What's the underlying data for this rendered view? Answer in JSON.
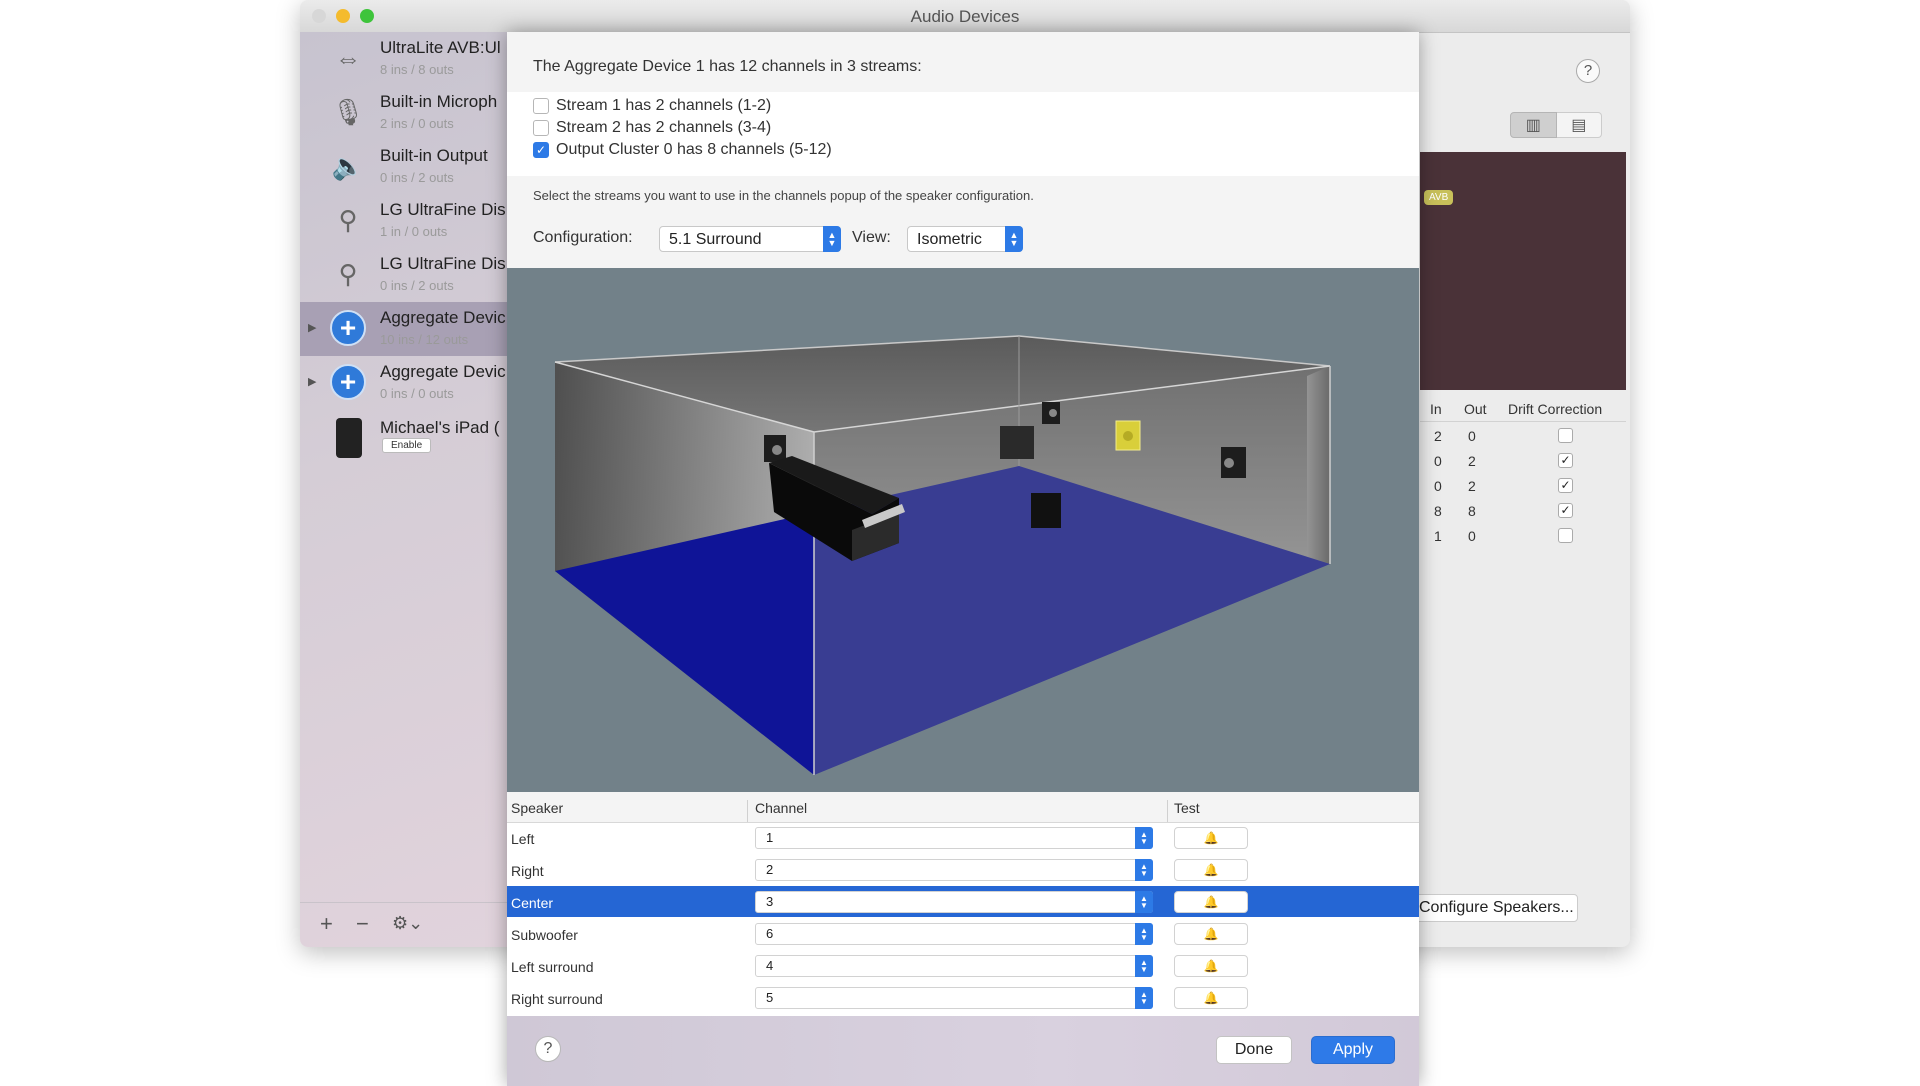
{
  "window": {
    "title": "Audio Devices"
  },
  "devices": [
    {
      "name": "UltraLite AVB:Ul",
      "sub": "8 ins / 8 outs",
      "icon": "arrows-lr-icon",
      "glyph": "⇔",
      "selected": false,
      "expandable": false
    },
    {
      "name": "Built-in Microph",
      "sub": "2 ins / 0 outs",
      "icon": "microphone-icon",
      "glyph": "🎙",
      "selected": false,
      "expandable": false
    },
    {
      "name": "Built-in Output",
      "sub": "0 ins / 2 outs",
      "icon": "speaker-icon",
      "glyph": "🔈",
      "selected": false,
      "expandable": false
    },
    {
      "name": "LG UltraFine Dis",
      "sub": "1 in / 0 outs",
      "icon": "usb-icon",
      "glyph": "⚲",
      "selected": false,
      "expandable": false
    },
    {
      "name": "LG UltraFine Dis",
      "sub": "0 ins / 2 outs",
      "icon": "usb-icon",
      "glyph": "⚲",
      "selected": false,
      "expandable": false
    },
    {
      "name": "Aggregate Devic",
      "sub": "10 ins / 12 outs",
      "icon": "aggregate-plus-icon",
      "glyph": "+",
      "selected": true,
      "expandable": true
    },
    {
      "name": "Aggregate Devic",
      "sub": "0 ins / 0 outs",
      "icon": "aggregate-plus-icon",
      "glyph": "+",
      "selected": false,
      "expandable": true
    }
  ],
  "ipad": {
    "name": "Michael's iPad (",
    "enable_label": "Enable"
  },
  "sidebar_bottom": {
    "add": "+",
    "remove": "−",
    "gear": "⚙⌄"
  },
  "right_pane": {
    "help": "?",
    "columns": {
      "in": "In",
      "out": "Out",
      "drift": "Drift Correction"
    },
    "rows": [
      {
        "in": "2",
        "out": "0",
        "drift": false
      },
      {
        "in": "0",
        "out": "2",
        "drift": true
      },
      {
        "in": "0",
        "out": "2",
        "drift": true
      },
      {
        "in": "8",
        "out": "8",
        "drift": true
      },
      {
        "in": "1",
        "out": "0",
        "drift": false
      }
    ],
    "avb_badge": "AVB",
    "configure_speakers": "Configure Speakers..."
  },
  "sheet": {
    "header": "The Aggregate Device 1 has 12 channels in 3 streams:",
    "streams": [
      {
        "label": "Stream 1 has 2 channels (1-2)",
        "checked": false
      },
      {
        "label": "Stream 2 has 2 channels (3-4)",
        "checked": false
      },
      {
        "label": "Output Cluster 0 has 8 channels (5-12)",
        "checked": true
      }
    ],
    "instructions": "Select the streams you want to use in the channels popup of the speaker configuration.",
    "configuration_label": "Configuration:",
    "configuration_value": "5.1 Surround",
    "view_label": "View:",
    "view_value": "Isometric",
    "table": {
      "columns": {
        "speaker": "Speaker",
        "channel": "Channel",
        "test": "Test"
      },
      "rows": [
        {
          "speaker": "Left",
          "channel": "1",
          "selected": false
        },
        {
          "speaker": "Right",
          "channel": "2",
          "selected": false
        },
        {
          "speaker": "Center",
          "channel": "3",
          "selected": true
        },
        {
          "speaker": "Subwoofer",
          "channel": "6",
          "selected": false
        },
        {
          "speaker": "Left surround",
          "channel": "4",
          "selected": false
        },
        {
          "speaker": "Right surround",
          "channel": "5",
          "selected": false
        }
      ],
      "test_glyph": "🔔"
    },
    "footer": {
      "help": "?",
      "done": "Done",
      "apply": "Apply"
    }
  },
  "colors": {
    "accent": "#2d7ae6",
    "selection": "#2566d4",
    "floor": "#0f1497",
    "viewport_bg": "#728189"
  }
}
